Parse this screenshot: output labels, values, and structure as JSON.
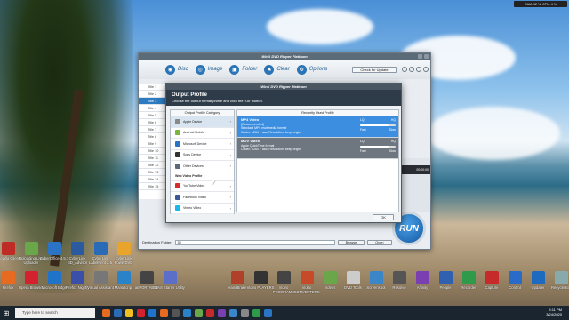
{
  "tray": {
    "text": "RAM: 12 %, CPU: 4 %"
  },
  "desktop_icons_row1": [
    {
      "label": "FileZilla Client",
      "icon": "filezilla-icon",
      "color": "#bf2b25"
    },
    {
      "label": "Uploading Live Uploader",
      "icon": "uploader-icon",
      "color": "#6aa64a"
    },
    {
      "label": "CyberOffice 4.5.1",
      "icon": "office-icon",
      "color": "#2b74c5"
    },
    {
      "label": "CyberLink BD_Advisor",
      "icon": "bd-advisor-icon",
      "color": "#2c5aa0"
    },
    {
      "label": "CyberLink LabelPrint 2.5",
      "icon": "labelprint-icon",
      "color": "#2a6bb8"
    },
    {
      "label": "CyberLink PowerDVD",
      "icon": "powerdvd-icon",
      "color": "#e8a42b"
    }
  ],
  "desktop_icons_row2": [
    {
      "label": "Firefox",
      "icon": "firefox-icon",
      "color": "#e66a1f"
    },
    {
      "label": "Opera Browser",
      "icon": "opera-icon",
      "color": "#d3222e"
    },
    {
      "label": "Microsoft Edge",
      "icon": "edge-icon",
      "color": "#1f73c9"
    },
    {
      "label": "Firefox Nightly",
      "icon": "nightly-icon",
      "color": "#3a4fa8"
    },
    {
      "label": "Virtual Assistant",
      "icon": "assistant-icon",
      "color": "#777"
    },
    {
      "label": "Manuscript",
      "icon": "manuscript-icon",
      "color": "#2a82c8"
    },
    {
      "label": "anPORTABLE",
      "icon": "portable-icon",
      "color": "#444"
    },
    {
      "label": "NAS Starter Utility",
      "icon": "nas-icon",
      "color": "#5b6ec8"
    }
  ],
  "desktop_icons_right": [
    {
      "label": "HandBrake",
      "icon": "handbrake-icon",
      "color": "#b0402a"
    },
    {
      "label": "Video PLAYERS",
      "icon": "players-icon",
      "color": "#333"
    },
    {
      "label": "Video PROGRAMS",
      "icon": "programs-icon",
      "color": "#444"
    },
    {
      "label": "Video CONVERTERS",
      "icon": "converters-icon",
      "color": "#c64a2a"
    },
    {
      "label": "Videos",
      "icon": "videos-icon",
      "color": "#6aa64a"
    },
    {
      "label": "DVD Tools",
      "icon": "dvd-icon",
      "color": "#ccc"
    },
    {
      "label": "Screenshot",
      "icon": "screenshot-icon",
      "color": "#3a86c9"
    },
    {
      "label": "Resolve",
      "icon": "resolve-icon",
      "color": "#555"
    },
    {
      "label": "Affinity",
      "icon": "affinity-icon",
      "color": "#7a3fb0"
    },
    {
      "label": "People",
      "icon": "people-icon",
      "color": "#3060b0"
    },
    {
      "label": "Recorder",
      "icon": "recorder-icon",
      "color": "#2e9a4a"
    },
    {
      "label": "Capture",
      "icon": "capture-icon",
      "color": "#c62a2a"
    },
    {
      "label": "Control",
      "icon": "control-icon",
      "color": "#2a6ac8"
    },
    {
      "label": "Updater",
      "icon": "updater-icon",
      "color": "#1e6ac0"
    },
    {
      "label": "Recycle Bin",
      "icon": "recycle-bin-icon",
      "color": "#8aa"
    }
  ],
  "app": {
    "title": "WinX DVD Ripper Platinum",
    "toolbar": [
      {
        "label": "Disc",
        "icon": "disc-icon",
        "glyph": "◉"
      },
      {
        "label": "Image",
        "icon": "image-icon",
        "glyph": "◎"
      },
      {
        "label": "Folder",
        "icon": "folder-icon",
        "glyph": "▣"
      },
      {
        "label": "Clear",
        "icon": "clear-icon",
        "glyph": "✖"
      },
      {
        "label": "Options",
        "icon": "options-icon",
        "glyph": "⚙"
      }
    ],
    "check_update": "Check for Update",
    "titles": [
      "Title 1",
      "Title 2",
      "Title 3",
      "Title 4",
      "Title 5",
      "Title 6",
      "Title 7",
      "Title 8",
      "Title 9",
      "Title 10",
      "Title 11",
      "Title 12",
      "Title 13",
      "Title 14",
      "Title 15"
    ],
    "time": "00:00:00",
    "dest_label": "Destination Folder:",
    "dest_value": "D:\\",
    "browse": "Browse",
    "open": "Open",
    "run": "RUN"
  },
  "dialog": {
    "title": "WinX DVD Ripper Platinum",
    "heading": "Output Profile",
    "subheading": "Choose the output format profile and click the \"Ok\" button.",
    "cat_header": "Output Profile Category",
    "recent_header": "Recently Used Profile",
    "categories": [
      {
        "label": "Apple Device",
        "icon": "apple-icon",
        "color": "#888"
      },
      {
        "label": "Android Mobile",
        "icon": "android-icon",
        "color": "#7cb342"
      },
      {
        "label": "Microsoft Device",
        "icon": "microsoft-icon",
        "color": "#2b74c5"
      },
      {
        "label": "Sony Device",
        "icon": "sony-icon",
        "color": "#333"
      },
      {
        "label": "Other Devices",
        "icon": "devices-icon",
        "color": "#5a6a7a"
      }
    ],
    "web_label": "Web Video Profile",
    "web_items": [
      {
        "label": "YouTube Video",
        "icon": "youtube-icon",
        "color": "#d32f2f"
      },
      {
        "label": "Facebook Video",
        "icon": "facebook-icon",
        "color": "#3b5998"
      },
      {
        "label": "Vimeo Video",
        "icon": "vimeo-icon",
        "color": "#1ab7ea"
      }
    ],
    "profiles": [
      {
        "name": "MP4 Video",
        "rec": "(Recommended)",
        "desc": "Standard MP4 multimedia format",
        "codec": "Codec: h264 + aac, Resolution: keep origin",
        "lq": "LQ",
        "hq": "HQ",
        "fast": "Fast",
        "slow": "Slow"
      },
      {
        "name": "MOV Video",
        "rec": "",
        "desc": "Apple QuickTime format",
        "codec": "Codec: h264 + aac, Resolution: keep origin",
        "lq": "LQ",
        "hq": "HQ",
        "fast": "Fast",
        "slow": "Slow"
      }
    ],
    "ok": "OK"
  },
  "taskbar": {
    "search": "Type here to search",
    "time": "5:11 PM",
    "date": "3/24/2020",
    "apps": [
      "#e66a1f",
      "#2a6bb8",
      "#f0c020",
      "#d3222e",
      "#1f73c9",
      "#e66a1f",
      "#555",
      "#2a82c8",
      "#6aa64a",
      "#c62a2a",
      "#7a3fb0",
      "#3a86c9",
      "#888",
      "#2e9a4a",
      "#2b74c5"
    ]
  }
}
